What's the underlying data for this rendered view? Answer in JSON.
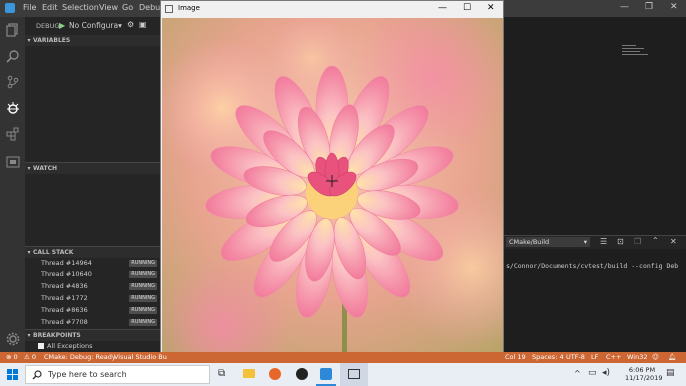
{
  "titlebar": {
    "menu": [
      "File",
      "Edit",
      "Selection",
      "View",
      "Go",
      "Debu"
    ],
    "controls": {
      "minimize": "—",
      "restore": "❐",
      "close": "✕"
    }
  },
  "debug_toolbar": {
    "label": "DEBUG",
    "config": "No Configura▾",
    "play_icon": "play-icon",
    "gear_icon": "gear-icon",
    "console_icon": "console-icon"
  },
  "sections": {
    "variables": "VARIABLES",
    "watch": "WATCH",
    "call_stack": "CALL STACK",
    "breakpoints": "BREAKPOINTS"
  },
  "threads": [
    {
      "name": "Thread #14964",
      "status": "RUNNING"
    },
    {
      "name": "Thread #10640",
      "status": "RUNNING"
    },
    {
      "name": "Thread #4836",
      "status": "RUNNING"
    },
    {
      "name": "Thread #1772",
      "status": "RUNNING"
    },
    {
      "name": "Thread #8636",
      "status": "RUNNING"
    },
    {
      "name": "Thread #7708",
      "status": "RUNNING"
    }
  ],
  "breakpoints": {
    "all_exceptions": "All Exceptions"
  },
  "image_window": {
    "title": "Image",
    "controls": {
      "minimize": "—",
      "maximize": "☐",
      "close": "✕"
    }
  },
  "terminal": {
    "dropdown": "CMake/Build",
    "line": "s/Connor/Documents/cvtest/build --config Deb"
  },
  "statusbar": {
    "errors": "⊗ 0",
    "warnings": "⚠ 0",
    "cmake": "CMake: Debug: Ready",
    "kit": "Visual Studio Bu",
    "col": "Col 19",
    "spaces": "Spaces: 4",
    "encoding": "UTF-8",
    "eol": "LF",
    "lang": "C++",
    "platform": "Win32"
  },
  "taskbar": {
    "search_placeholder": "Type here to search",
    "time": "6:06 PM",
    "date": "11/17/2019",
    "apps": [
      "task-view-icon",
      "file-explorer-icon",
      "firefox-icon",
      "unity-icon",
      "vscode-icon",
      "image-viewer-icon"
    ]
  },
  "colors": {
    "statusbar": "#cc6633",
    "titlebar": "#3c3c3c",
    "sidebar": "#252526",
    "activity": "#333333"
  }
}
